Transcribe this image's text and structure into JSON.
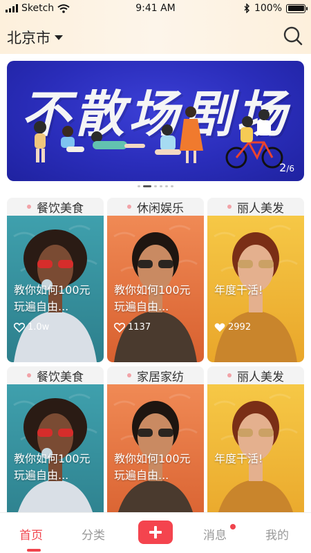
{
  "status_bar": {
    "carrier": "Sketch",
    "time": "9:41 AM",
    "battery": "100%",
    "battery_level": 1.0
  },
  "header": {
    "city": "北京市",
    "search_icon": "search-icon"
  },
  "banner": {
    "title": "不散场剧场",
    "counter_current": "2",
    "counter_total": "/6",
    "dots_count": 6,
    "active_dot": 1
  },
  "cards": [
    {
      "category": "餐饮美食",
      "text": "教你如何100元玩遍自由...",
      "likes": "1.0w",
      "liked": false,
      "theme": "teal"
    },
    {
      "category": "休闲娱乐",
      "text": "教你如何100元玩遍自由...",
      "likes": "1137",
      "liked": false,
      "theme": "orange"
    },
    {
      "category": "丽人美发",
      "text": "年度干活!",
      "likes": "2992",
      "liked": true,
      "theme": "yellow"
    },
    {
      "category": "餐饮美食",
      "text": "教你如何100元玩遍自由...",
      "likes": "",
      "liked": false,
      "theme": "teal"
    },
    {
      "category": "家居家纺",
      "text": "教你如何100元玩遍自由...",
      "likes": "",
      "liked": false,
      "theme": "orange"
    },
    {
      "category": "丽人美发",
      "text": "年度干活!",
      "likes": "",
      "liked": false,
      "theme": "yellow"
    }
  ],
  "bottom_nav": {
    "home": "首页",
    "category": "分类",
    "add": "+",
    "messages": "消息",
    "mine": "我的",
    "accent": "#f0444d"
  },
  "colors": {
    "teal": "#3e9aa8",
    "orange": "#e8764a",
    "yellow": "#f2b93a",
    "banner_blue": "#2a2dba"
  }
}
